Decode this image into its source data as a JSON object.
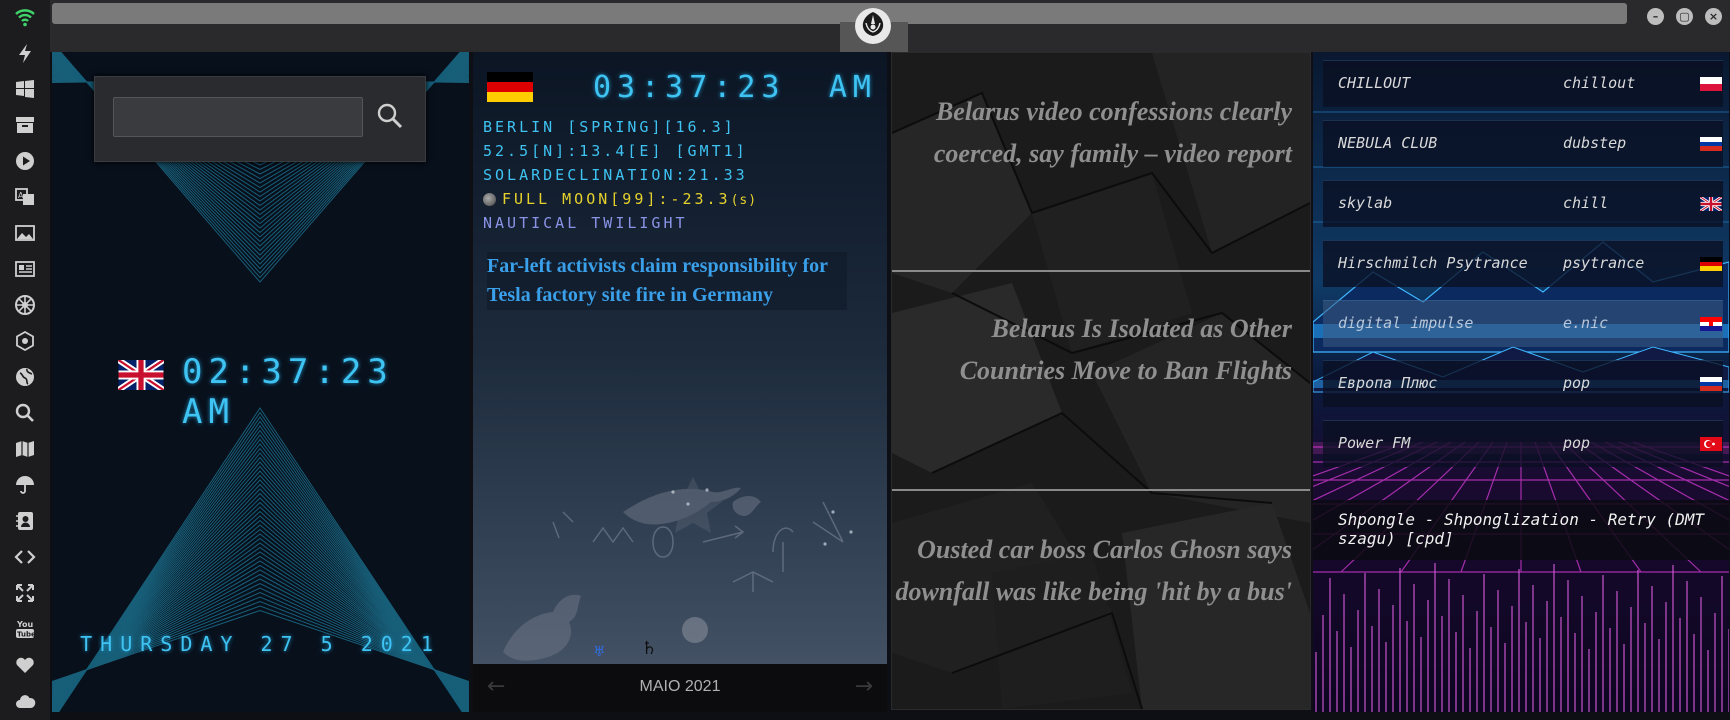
{
  "sidebar": {
    "icons": [
      "wifi-icon",
      "lightning-icon",
      "windows-icon",
      "archive-icon",
      "play-icon",
      "translate-icon",
      "image-icon",
      "news-icon",
      "rebel-alliance-icon",
      "empire-icon",
      "globe-icon",
      "search-icon",
      "map-icon",
      "umbrella-icon",
      "contacts-icon",
      "code-icon",
      "fullscreen-icon",
      "youtube-icon",
      "heart-icon",
      "cloud-icon"
    ]
  },
  "window": {
    "minimize": "–",
    "maximize": "▢",
    "close": "×"
  },
  "clock_uk": {
    "time": "02:37:23 AM",
    "date": "THURSDAY 27 5 2021"
  },
  "clock_de": {
    "time": "03:37:23",
    "ampm": "AM",
    "location": "BERLIN [SPRING][16.3]",
    "coords": "52.5[N]:13.4[E] [GMT1]",
    "solar": "SOLARDECLINATION:21.33",
    "moon": "FULL MOON[99]:-23.3",
    "moon_suffix": "(s)",
    "twilight": "NAUTICAL TWILIGHT",
    "headline": "Far-left activists claim responsibility for Tesla factory site fire in Germany",
    "calendar_label": "MAIO 2021",
    "prev": "←",
    "next": "→"
  },
  "news": [
    {
      "text": "Belarus video confessions clearly coerced, say family – video report"
    },
    {
      "text": "Belarus Is Isolated as Other Countries Move to Ban Flights"
    },
    {
      "text": "Ousted car boss Carlos Ghosn says downfall was like being 'hit by a bus'"
    }
  ],
  "radio": {
    "stations": [
      {
        "name": "CHILLOUT",
        "genre": "chillout",
        "flag": "poland"
      },
      {
        "name": "NEBULA CLUB",
        "genre": "dubstep",
        "flag": "russia"
      },
      {
        "name": "skylab",
        "genre": "chill",
        "flag": "uk"
      },
      {
        "name": "Hirschmilch Psytrance",
        "genre": "psytrance",
        "flag": "germany"
      },
      {
        "name": "digital impulse",
        "genre": "e.nic",
        "flag": "croatia"
      },
      {
        "name": "Европа Плюс",
        "genre": "pop",
        "flag": "russia"
      },
      {
        "name": "Power FM",
        "genre": "pop",
        "flag": "turkey"
      }
    ],
    "now_playing": "Shpongle - Shponglization - Retry (DMT szagu) [cpd]"
  },
  "search": {
    "placeholder": ""
  },
  "colors": {
    "accent": "#3ec3f2",
    "moon": "#e6d22c",
    "twilight": "#8a93e6",
    "headline": "#3aa0ea"
  }
}
